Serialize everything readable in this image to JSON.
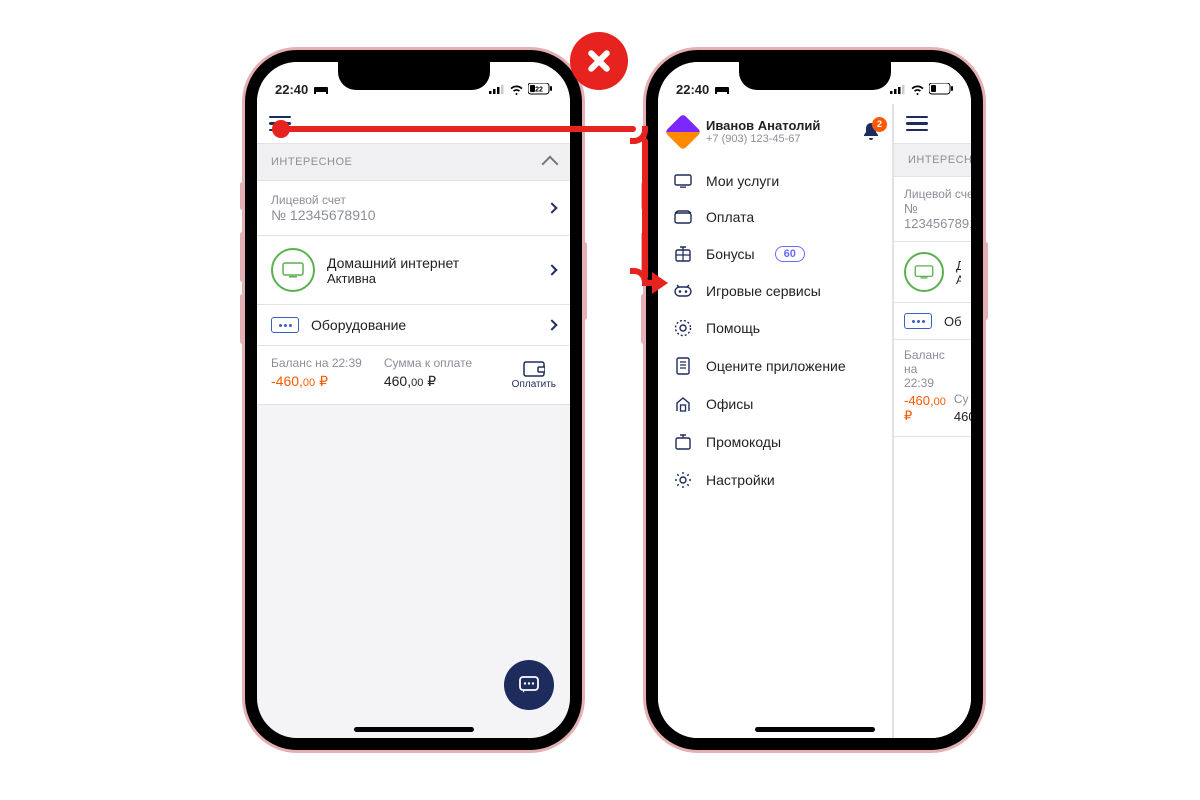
{
  "status": {
    "time": "22:40",
    "battery": "22"
  },
  "section_header": "ИНТЕРЕСНОЕ",
  "account": {
    "label": "Лицевой счет",
    "number": "№ 12345678910"
  },
  "service": {
    "title": "Домашний интернет",
    "status": "Активна"
  },
  "equipment": {
    "label": "Оборудование"
  },
  "balance": {
    "label": "Баланс на 22:39",
    "value_int": "-460,",
    "value_dec": "00",
    "unit": "₽"
  },
  "amount_due": {
    "label": "Сумма к оплате",
    "value_int": "460,",
    "value_dec": "00",
    "unit": "₽"
  },
  "pay_button": "Оплатить",
  "user": {
    "name": "Иванов Анатолий",
    "phone": "+7 (903) 123-45-67",
    "notifications": "2"
  },
  "bonus_pill": "60",
  "menu": [
    {
      "label": "Мои услуги"
    },
    {
      "label": "Оплата"
    },
    {
      "label": "Бонусы",
      "pill": true
    },
    {
      "label": "Игровые сервисы"
    },
    {
      "label": "Помощь"
    },
    {
      "label": "Оцените приложение"
    },
    {
      "label": "Офисы"
    },
    {
      "label": "Промокоды"
    },
    {
      "label": "Настройки"
    }
  ]
}
